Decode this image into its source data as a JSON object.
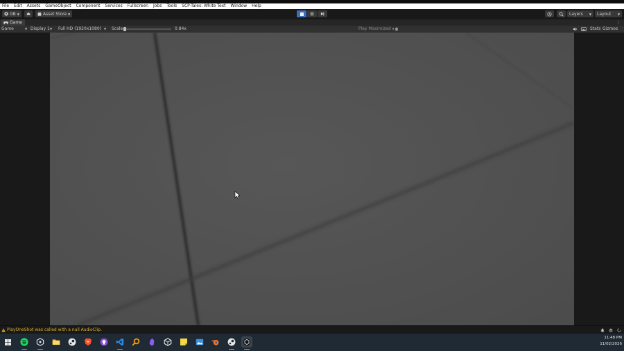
{
  "menubar": {
    "items": [
      "File",
      "Edit",
      "Assets",
      "GameObject",
      "Component",
      "Services",
      "Fullscreen",
      "Jobs",
      "Tools",
      "SCP-Tales: White Text",
      "Window",
      "Help"
    ]
  },
  "toolbar": {
    "account_label": "GB",
    "asset_store_label": "Asset Store",
    "layers_label": "Layers",
    "layout_label": "Layout"
  },
  "game_tab": {
    "label": "Game"
  },
  "game_bar": {
    "view_select": "Game",
    "display_select": "Display 1",
    "resolution_select": "Full HD (1920x1080)",
    "scale_label": "Scale",
    "scale_value": "0.84x",
    "play_mode_select": "Play Maximized",
    "stats_label": "Stats",
    "gizmos_label": "Gizmos"
  },
  "console": {
    "message": "PlayOneShot was called with a null AudioClip."
  },
  "taskbar": {
    "apps": [
      "start",
      "spotify",
      "unity-hub",
      "file-explorer",
      "steam",
      "brave",
      "github-desktop",
      "vscode",
      "search-app",
      "obsidian",
      "unity",
      "sticky-notes",
      "photos",
      "blender",
      "steam-2",
      "unity-editor"
    ],
    "time": "11:48 PM",
    "date": "11/02/2026"
  },
  "colors": {
    "floor": "#545454",
    "editor_bg": "#191919",
    "warning": "#e0b32a",
    "taskbar": "#202a34"
  }
}
